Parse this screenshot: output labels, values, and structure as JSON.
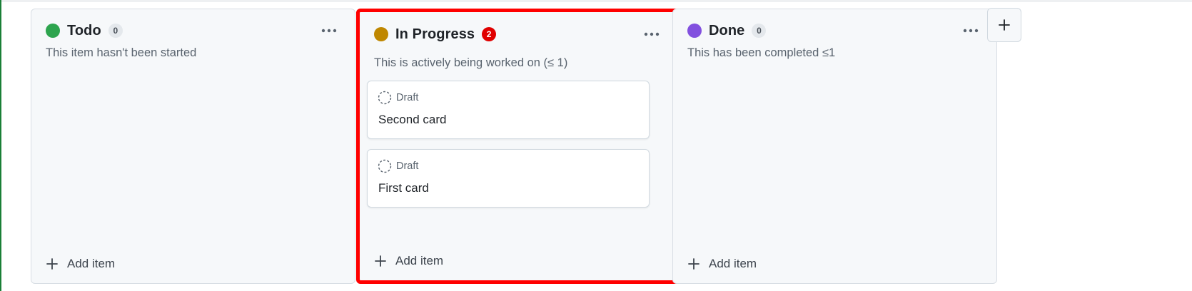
{
  "board": {
    "columns": [
      {
        "title": "Todo",
        "count": "0",
        "description": "This item hasn't been started",
        "dot_color": "#2da44e",
        "add_label": "Add item",
        "cards": []
      },
      {
        "title": "In Progress",
        "count": "2",
        "description": "This is actively being worked on (≤ 1)",
        "dot_color": "#bf8700",
        "add_label": "Add item",
        "highlight_color": "#ff0000",
        "cards": [
          {
            "status": "Draft",
            "title": "Second card"
          },
          {
            "status": "Draft",
            "title": "First card"
          }
        ]
      },
      {
        "title": "Done",
        "count": "0",
        "description": "This has been completed ≤1",
        "dot_color": "#8250df",
        "add_label": "Add item",
        "cards": []
      }
    ],
    "add_column_icon": "plus-icon"
  }
}
